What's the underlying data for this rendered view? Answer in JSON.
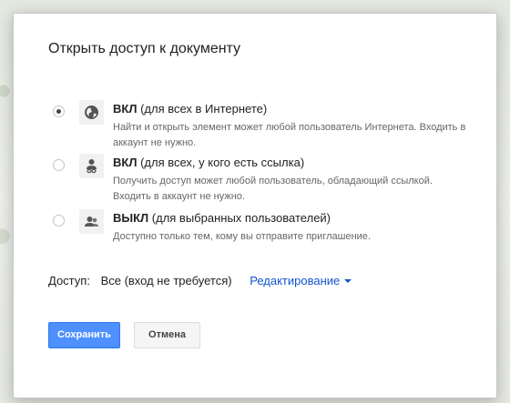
{
  "dialog": {
    "title": "Открыть доступ к документу"
  },
  "options": [
    {
      "head_bold": "ВКЛ",
      "head_rest": " (для всех в Интернете)",
      "desc": "Найти и открыть элемент может любой пользователь Интернета. Входить в аккаунт не нужно.",
      "icon": "globe-icon",
      "checked": true
    },
    {
      "head_bold": "ВКЛ",
      "head_rest": " (для всех, у кого есть ссылка)",
      "desc": "Получить доступ может любой пользователь, обладающий ссылкой. Входить в аккаунт не нужно.",
      "icon": "person-link-icon",
      "checked": false
    },
    {
      "head_bold": "ВЫКЛ",
      "head_rest": " (для выбранных пользователей)",
      "desc": "Доступно только тем, кому вы отправите приглашение.",
      "icon": "people-icon",
      "checked": false
    }
  ],
  "access": {
    "label": "Доступ:",
    "value": "Все (вход не требуется)",
    "permission": "Редактирование"
  },
  "buttons": {
    "save": "Сохранить",
    "cancel": "Отмена"
  },
  "colors": {
    "primary_button": "#4d90fe",
    "link": "#1155cc"
  }
}
